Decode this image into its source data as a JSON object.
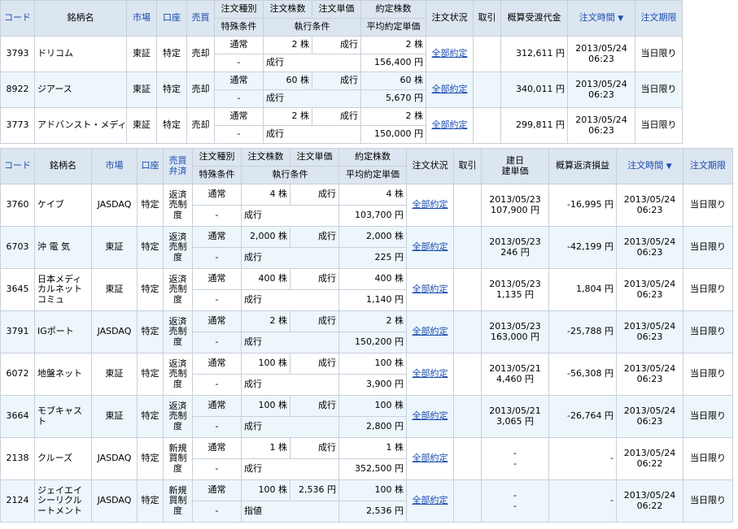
{
  "t1": {
    "headers": {
      "code": "コード",
      "name": "銘柄名",
      "market": "市場",
      "account": "口座",
      "side": "売買",
      "order_type": "注文種別",
      "special_cond": "特殊条件",
      "order_qty": "注文株数",
      "order_price": "注文単価",
      "exec_cond": "執行条件",
      "filled_qty": "約定株数",
      "avg_price": "平均約定単価",
      "status": "注文状況",
      "cancel": "取引",
      "est_amount": "概算受渡代金",
      "order_time": "注文時間",
      "sort_arrow": "▼",
      "expiry": "注文期限"
    },
    "rows": [
      {
        "code": "3793",
        "name": "ドリコム",
        "market": "東証",
        "account": "特定",
        "side": "売却",
        "order_type": "通常",
        "special": "-",
        "qty": "2 株",
        "price": "成行",
        "exec": "成行",
        "filled": "2 株",
        "avg": "156,400 円",
        "status": "全部約定",
        "amount": "312,611 円",
        "date": "2013/05/24",
        "time": "06:23",
        "expiry": "当日限り"
      },
      {
        "code": "8922",
        "name": "ジアース",
        "market": "東証",
        "account": "特定",
        "side": "売却",
        "order_type": "通常",
        "special": "-",
        "qty": "60 株",
        "price": "成行",
        "exec": "成行",
        "filled": "60 株",
        "avg": "5,670 円",
        "status": "全部約定",
        "amount": "340,011 円",
        "date": "2013/05/24",
        "time": "06:23",
        "expiry": "当日限り"
      },
      {
        "code": "3773",
        "name": "アドバンスト・メディア",
        "market": "東証",
        "account": "特定",
        "side": "売却",
        "order_type": "通常",
        "special": "-",
        "qty": "2 株",
        "price": "成行",
        "exec": "成行",
        "filled": "2 株",
        "avg": "150,000 円",
        "status": "全部約定",
        "amount": "299,811 円",
        "date": "2013/05/24",
        "time": "06:23",
        "expiry": "当日限り"
      }
    ]
  },
  "t2": {
    "headers": {
      "code": "コード",
      "name": "銘柄名",
      "market": "市場",
      "account": "口座",
      "side1": "売買",
      "side2": "弁済",
      "order_type": "注文種別",
      "special_cond": "特殊条件",
      "order_qty": "注文株数",
      "order_price": "注文単価",
      "exec_cond": "執行条件",
      "filled_qty": "約定株数",
      "avg_price": "平均約定単価",
      "status": "注文状況",
      "cancel": "取引",
      "build_date": "建日",
      "build_price": "建単価",
      "pnl": "概算返済損益",
      "order_time": "注文時間",
      "sort_arrow": "▼",
      "expiry": "注文期限"
    },
    "rows": [
      {
        "code": "3760",
        "name": "ケイブ",
        "market": "JASDAQ",
        "account": "特定",
        "side": "返済売制度",
        "order_type": "通常",
        "special": "-",
        "qty": "4 株",
        "price": "成行",
        "exec": "成行",
        "filled": "4 株",
        "avg": "103,700 円",
        "status": "全部約定",
        "bdate": "2013/05/23",
        "bprice": "107,900 円",
        "pnl": "-16,995 円",
        "date": "2013/05/24",
        "time": "06:23",
        "expiry": "当日限り"
      },
      {
        "code": "6703",
        "name": "沖 電 気",
        "market": "東証",
        "account": "特定",
        "side": "返済売制度",
        "order_type": "通常",
        "special": "-",
        "qty": "2,000 株",
        "price": "成行",
        "exec": "成行",
        "filled": "2,000 株",
        "avg": "225 円",
        "status": "全部約定",
        "bdate": "2013/05/23",
        "bprice": "246 円",
        "pnl": "-42,199 円",
        "date": "2013/05/24",
        "time": "06:23",
        "expiry": "当日限り"
      },
      {
        "code": "3645",
        "name": "日本メディカルネットコミュ",
        "market": "東証",
        "account": "特定",
        "side": "返済売制度",
        "order_type": "通常",
        "special": "-",
        "qty": "400 株",
        "price": "成行",
        "exec": "成行",
        "filled": "400 株",
        "avg": "1,140 円",
        "status": "全部約定",
        "bdate": "2013/05/23",
        "bprice": "1,135 円",
        "pnl": "1,804 円",
        "date": "2013/05/24",
        "time": "06:23",
        "expiry": "当日限り"
      },
      {
        "code": "3791",
        "name": "IGポート",
        "market": "JASDAQ",
        "account": "特定",
        "side": "返済売制度",
        "order_type": "通常",
        "special": "-",
        "qty": "2 株",
        "price": "成行",
        "exec": "成行",
        "filled": "2 株",
        "avg": "150,200 円",
        "status": "全部約定",
        "bdate": "2013/05/23",
        "bprice": "163,000 円",
        "pnl": "-25,788 円",
        "date": "2013/05/24",
        "time": "06:23",
        "expiry": "当日限り"
      },
      {
        "code": "6072",
        "name": "地盤ネット",
        "market": "東証",
        "account": "特定",
        "side": "返済売制度",
        "order_type": "通常",
        "special": "-",
        "qty": "100 株",
        "price": "成行",
        "exec": "成行",
        "filled": "100 株",
        "avg": "3,900 円",
        "status": "全部約定",
        "bdate": "2013/05/21",
        "bprice": "4,460 円",
        "pnl": "-56,308 円",
        "date": "2013/05/24",
        "time": "06:23",
        "expiry": "当日限り"
      },
      {
        "code": "3664",
        "name": "モブキャスト",
        "market": "東証",
        "account": "特定",
        "side": "返済売制度",
        "order_type": "通常",
        "special": "-",
        "qty": "100 株",
        "price": "成行",
        "exec": "成行",
        "filled": "100 株",
        "avg": "2,800 円",
        "status": "全部約定",
        "bdate": "2013/05/21",
        "bprice": "3,065 円",
        "pnl": "-26,764 円",
        "date": "2013/05/24",
        "time": "06:23",
        "expiry": "当日限り"
      },
      {
        "code": "2138",
        "name": "クルーズ",
        "market": "JASDAQ",
        "account": "特定",
        "side": "新規買制度",
        "order_type": "通常",
        "special": "-",
        "qty": "1 株",
        "price": "成行",
        "exec": "成行",
        "filled": "1 株",
        "avg": "352,500 円",
        "status": "全部約定",
        "bdate": "-",
        "bprice": "-",
        "pnl": "-",
        "date": "2013/05/24",
        "time": "06:22",
        "expiry": "当日限り"
      },
      {
        "code": "2124",
        "name": "ジェイエイシーリクルートメント",
        "market": "JASDAQ",
        "account": "特定",
        "side": "新規買制度",
        "order_type": "通常",
        "special": "-",
        "qty": "100 株",
        "price": "2,536 円",
        "exec": "指値",
        "filled": "100 株",
        "avg": "2,536 円",
        "status": "全部約定",
        "bdate": "-",
        "bprice": "-",
        "pnl": "-",
        "date": "2013/05/24",
        "time": "06:22",
        "expiry": "当日限り"
      }
    ]
  }
}
